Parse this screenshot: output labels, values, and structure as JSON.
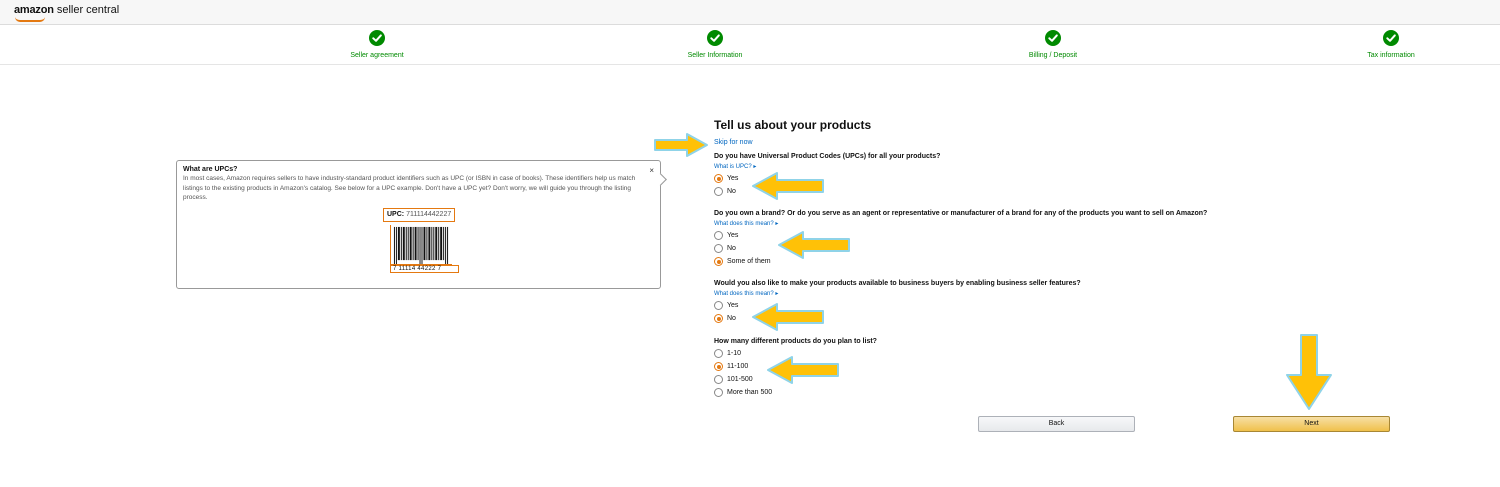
{
  "app": {
    "brand": "amazon",
    "product": "seller central"
  },
  "steps": [
    {
      "label": "Seller agreement",
      "status": "complete"
    },
    {
      "label": "Seller Information",
      "status": "complete"
    },
    {
      "label": "Billing / Deposit",
      "status": "complete"
    },
    {
      "label": "Tax information",
      "status": "complete"
    }
  ],
  "upc_panel": {
    "title": "What are UPCs?",
    "body": "In most cases, Amazon requires sellers to have industry-standard product identifiers such as UPC (or ISBN in case of books). These identifiers help us match listings to the existing products in Amazon's catalog. See below for a UPC example. Don't have a UPC yet? Don't worry, we will guide you through the listing process.",
    "close": "×",
    "example_label": "UPC:",
    "example_code": "711114442227",
    "barcode_digits": "7  11114  44222  7"
  },
  "form": {
    "title": "Tell us about your products",
    "skip": "Skip for now",
    "questions": [
      {
        "text": "Do you have Universal Product Codes (UPCs) for all your products?",
        "help": "What is UPC?",
        "options": [
          "Yes",
          "No"
        ],
        "selected": "Yes"
      },
      {
        "text": "Do you own a brand? Or do you serve as an agent or representative or manufacturer of a brand for any of the products you want to sell on Amazon?",
        "help": "What does this mean?",
        "options": [
          "Yes",
          "No",
          "Some of them"
        ],
        "selected": "Some of them"
      },
      {
        "text": "Would you also like to make your products available to business buyers by enabling business seller features?",
        "help": "What does this mean?",
        "options": [
          "Yes",
          "No"
        ],
        "selected": "No"
      },
      {
        "text": "How many different products do you plan to list?",
        "help": "",
        "options": [
          "1-10",
          "11-100",
          "101-500",
          "More than 500"
        ],
        "selected": "11-100"
      }
    ],
    "back": "Back",
    "next": "Next"
  },
  "colors": {
    "accent": "#e47911",
    "link": "#0066c0",
    "success": "#008a00",
    "annotation_arrow": "#ffc107",
    "annotation_outline": "#8fd3e8"
  }
}
